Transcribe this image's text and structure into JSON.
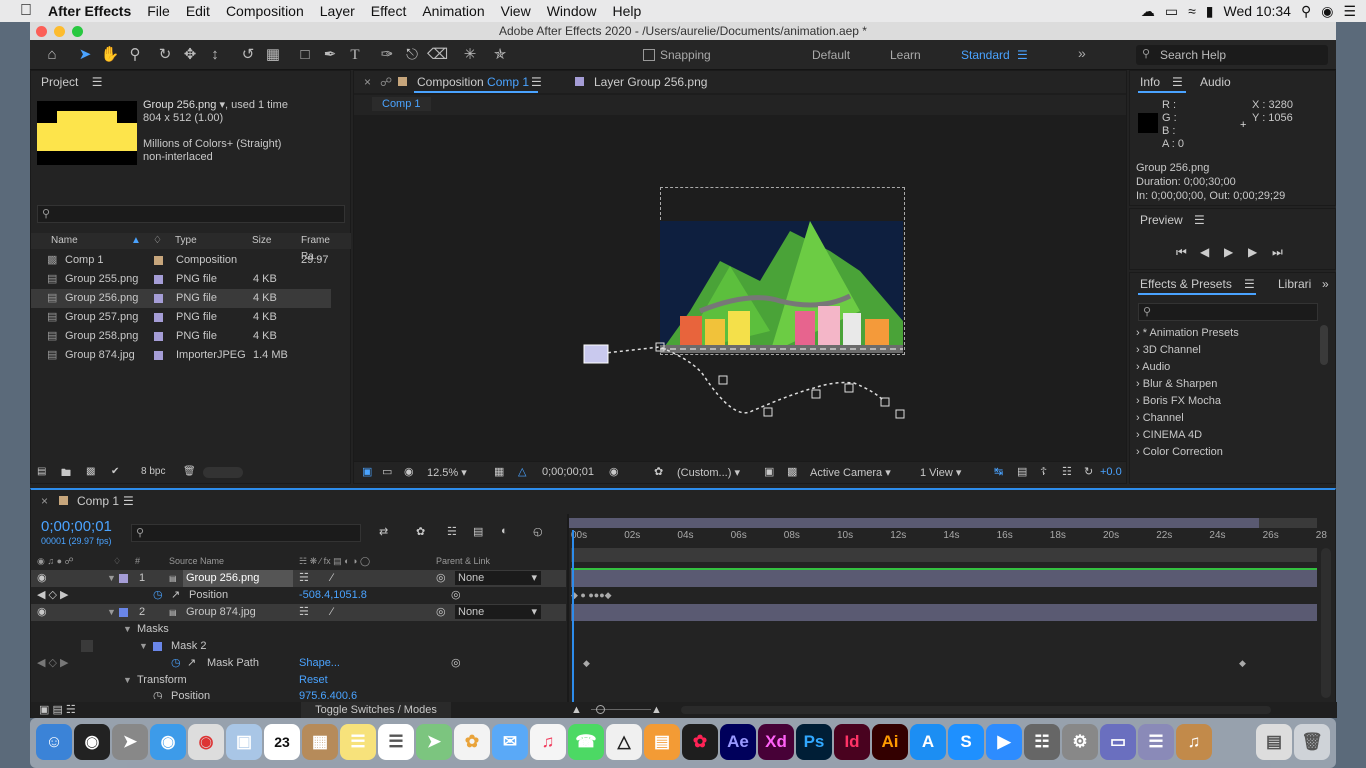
{
  "menubar": {
    "app": "After Effects",
    "items": [
      "File",
      "Edit",
      "Composition",
      "Layer",
      "Effect",
      "Animation",
      "View",
      "Window",
      "Help"
    ],
    "clock": "Wed 10:34"
  },
  "window": {
    "title": "Adobe After Effects 2020 - /Users/aurelie/Documents/animation.aep *"
  },
  "toolbar": {
    "snapping": "Snapping",
    "workspaces": [
      "Default",
      "Learn",
      "Standard"
    ],
    "search_placeholder": "Search Help"
  },
  "project": {
    "tab": "Project",
    "sel_name": "Group 256.png",
    "sel_used": ", used 1 time",
    "sel_dims": "804 x 512 (1.00)",
    "sel_color": "Millions of Colors+ (Straight)",
    "sel_interlace": "non-interlaced",
    "columns": [
      "Name",
      "Type",
      "Size",
      "Frame Ra..."
    ],
    "items": [
      {
        "name": "Comp 1",
        "type": "Composition",
        "size": "",
        "rate": "29.97"
      },
      {
        "name": "Group 255.png",
        "type": "PNG file",
        "size": "4 KB",
        "rate": ""
      },
      {
        "name": "Group 256.png",
        "type": "PNG file",
        "size": "4 KB",
        "rate": ""
      },
      {
        "name": "Group 257.png",
        "type": "PNG file",
        "size": "4 KB",
        "rate": ""
      },
      {
        "name": "Group 258.png",
        "type": "PNG file",
        "size": "4 KB",
        "rate": ""
      },
      {
        "name": "Group 874.jpg",
        "type": "ImporterJPEG",
        "size": "1.4 MB",
        "rate": ""
      }
    ],
    "bpc": "8 bpc"
  },
  "comp": {
    "tab_prefix": "Composition",
    "tab_name": "Comp 1",
    "layer_tab": "Layer Group 256.png",
    "crumb": "Comp 1",
    "zoom": "12.5%",
    "time": "0;00;00;01",
    "res": "(Custom...)",
    "camera": "Active Camera",
    "view": "1 View",
    "exposure": "+0.0"
  },
  "info": {
    "tab": "Info",
    "tab2": "Audio",
    "r": "R :",
    "g": "G :",
    "b": "B :",
    "a": "A : 0",
    "x": "X : 3280",
    "y": "Y : 1056",
    "name": "Group 256.png",
    "duration": "Duration: 0;00;30;00",
    "inout": "In: 0;00;00;00, Out: 0;00;29;29"
  },
  "preview": {
    "tab": "Preview"
  },
  "effects": {
    "tab": "Effects & Presets",
    "tab2": "Librari",
    "items": [
      "* Animation Presets",
      "3D Channel",
      "Audio",
      "Blur & Sharpen",
      "Boris FX Mocha",
      "Channel",
      "CINEMA 4D",
      "Color Correction"
    ]
  },
  "timeline": {
    "tab": "Comp 1",
    "timecode": "0;00;00;01",
    "fps": "00001 (29.97 fps)",
    "col_source": "Source Name",
    "col_parent": "Parent & Link",
    "ticks": [
      "00s",
      "02s",
      "04s",
      "06s",
      "08s",
      "10s",
      "12s",
      "14s",
      "16s",
      "18s",
      "20s",
      "22s",
      "24s",
      "26s",
      "28"
    ],
    "layers": [
      {
        "num": "1",
        "name": "Group 256.png",
        "parent": "None"
      },
      {
        "num": "2",
        "name": "Group 874.jpg",
        "parent": "None"
      }
    ],
    "position_label": "Position",
    "position_value": "-508.4,1051.8",
    "masks": "Masks",
    "mask2": "Mask 2",
    "mask_path": "Mask Path",
    "mask_path_value": "Shape...",
    "transform": "Transform",
    "transform_value": "Reset",
    "position2_value": "975.6,400.6",
    "toggle": "Toggle Switches / Modes"
  },
  "dock": {
    "date": "23",
    "apps": [
      "Ae",
      "Xd",
      "Ps",
      "Id",
      "Ai"
    ]
  },
  "colors": {
    "accent": "#2d8ceb",
    "label_purple": "#a59dd6",
    "track": "#5a5a72"
  }
}
